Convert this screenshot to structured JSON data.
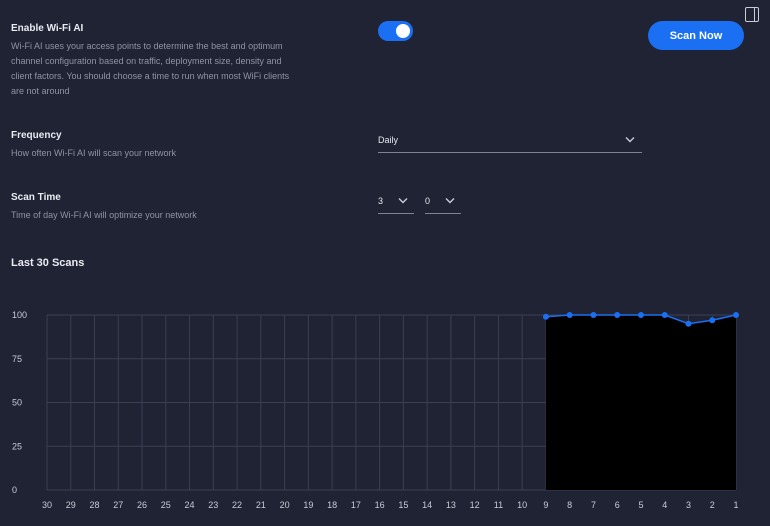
{
  "wifi_ai": {
    "title": "Enable Wi-Fi AI",
    "desc_lines": [
      "Wi-Fi AI uses your access points to determine the best and optimum",
      "channel configuration based on traffic, deployment size, density and",
      "client factors. You should choose a time to run when most WiFi clients",
      "are not around"
    ],
    "enabled": true,
    "scan_button": "Scan Now"
  },
  "frequency": {
    "title": "Frequency",
    "desc": "How often Wi-Fi AI will scan your network",
    "value": "Daily"
  },
  "scan_time": {
    "title": "Scan Time",
    "desc": "Time of day Wi-Fi AI will optimize your network",
    "hour": "3",
    "minute": "0"
  },
  "chart_section": {
    "title": "Last 30 Scans"
  },
  "colors": {
    "accent": "#1b6ff2",
    "background": "#1f2334",
    "grid": "#3a3f52",
    "filled_area": "#000000"
  },
  "chart_data": {
    "type": "area",
    "x": [
      "30",
      "29",
      "28",
      "27",
      "26",
      "25",
      "24",
      "23",
      "22",
      "21",
      "20",
      "19",
      "18",
      "17",
      "16",
      "15",
      "14",
      "13",
      "12",
      "11",
      "10",
      "9",
      "8",
      "7",
      "6",
      "5",
      "4",
      "3",
      "2",
      "1"
    ],
    "values": [
      null,
      null,
      null,
      null,
      null,
      null,
      null,
      null,
      null,
      null,
      null,
      null,
      null,
      null,
      null,
      null,
      null,
      null,
      null,
      null,
      null,
      99,
      100,
      100,
      100,
      100,
      100,
      95,
      97,
      100
    ],
    "y_ticks": [
      "0",
      "25",
      "50",
      "75",
      "100"
    ],
    "ylim": [
      0,
      100
    ],
    "grid": true
  }
}
